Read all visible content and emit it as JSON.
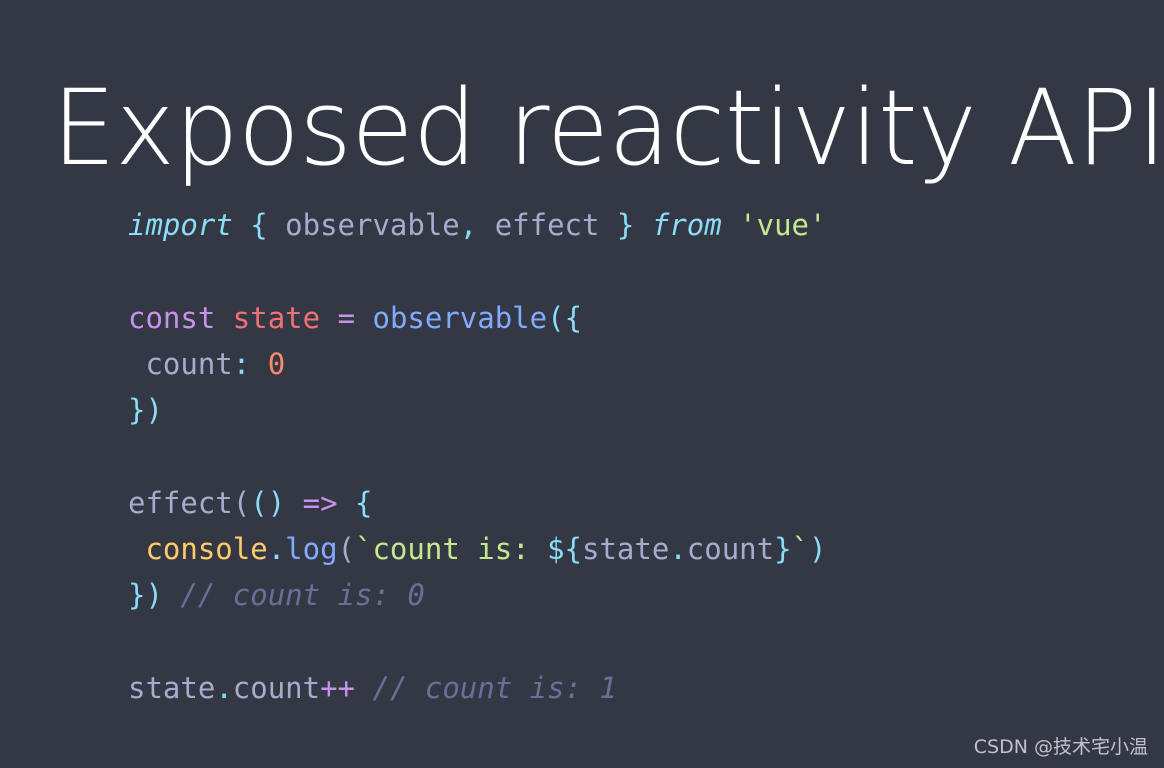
{
  "slide": {
    "title": "Exposed reactivity API",
    "background_color": "#343845",
    "title_color": "#FFFFFF"
  },
  "code": {
    "language": "javascript",
    "lines": [
      {
        "index": 1,
        "text": "import { observable, effect } from 'vue'",
        "tokens": [
          {
            "text": "import",
            "type": "keyword",
            "color": "#89DDF7"
          },
          {
            "text": " ",
            "type": "plain",
            "color": "#A6ACCD"
          },
          {
            "text": "{",
            "type": "punct",
            "color": "#89DDF7"
          },
          {
            "text": " observable",
            "type": "plain",
            "color": "#A6ACCD"
          },
          {
            "text": ",",
            "type": "punct",
            "color": "#89DDF7"
          },
          {
            "text": " effect ",
            "type": "plain",
            "color": "#A6ACCD"
          },
          {
            "text": "}",
            "type": "punct",
            "color": "#89DDF7"
          },
          {
            "text": " ",
            "type": "plain",
            "color": "#A6ACCD"
          },
          {
            "text": "from",
            "type": "keyword",
            "color": "#89DDF7"
          },
          {
            "text": " ",
            "type": "plain",
            "color": "#A6ACCD"
          },
          {
            "text": "'vue'",
            "type": "string",
            "color": "#C3E88D"
          }
        ]
      },
      {
        "index": 2,
        "text": "",
        "tokens": []
      },
      {
        "index": 3,
        "text": "const state = observable({",
        "tokens": [
          {
            "text": "const",
            "type": "const",
            "color": "#C792EA"
          },
          {
            "text": " ",
            "type": "plain",
            "color": "#A6ACCD"
          },
          {
            "text": "state",
            "type": "var",
            "color": "#F07178"
          },
          {
            "text": " ",
            "type": "plain",
            "color": "#A6ACCD"
          },
          {
            "text": "=",
            "type": "operator",
            "color": "#C792EA"
          },
          {
            "text": " ",
            "type": "plain",
            "color": "#A6ACCD"
          },
          {
            "text": "observable",
            "type": "func",
            "color": "#82AAFF"
          },
          {
            "text": "({",
            "type": "punct",
            "color": "#89DDF7"
          }
        ]
      },
      {
        "index": 4,
        "text": " count: 0",
        "tokens": [
          {
            "text": " count",
            "type": "plain",
            "color": "#A6ACCD"
          },
          {
            "text": ":",
            "type": "punct",
            "color": "#89DDF7"
          },
          {
            "text": " ",
            "type": "plain",
            "color": "#A6ACCD"
          },
          {
            "text": "0",
            "type": "number",
            "color": "#F78C6C"
          }
        ]
      },
      {
        "index": 5,
        "text": "})",
        "tokens": [
          {
            "text": "})",
            "type": "punct",
            "color": "#89DDF7"
          }
        ]
      },
      {
        "index": 6,
        "text": "",
        "tokens": []
      },
      {
        "index": 7,
        "text": "effect(() => {",
        "tokens": [
          {
            "text": "effect",
            "type": "plain",
            "color": "#A6ACCD"
          },
          {
            "text": "(",
            "type": "gray",
            "color": "#A6ACCD"
          },
          {
            "text": "()",
            "type": "punct",
            "color": "#89DDF7"
          },
          {
            "text": " ",
            "type": "plain",
            "color": "#A6ACCD"
          },
          {
            "text": "=>",
            "type": "operator",
            "color": "#C792EA"
          },
          {
            "text": " ",
            "type": "plain",
            "color": "#A6ACCD"
          },
          {
            "text": "{",
            "type": "punct",
            "color": "#89DDF7"
          }
        ]
      },
      {
        "index": 8,
        "text": " console.log(`count is: ${state.count}`)",
        "tokens": [
          {
            "text": " ",
            "type": "plain",
            "color": "#A6ACCD"
          },
          {
            "text": "console",
            "type": "object",
            "color": "#FFCB6B"
          },
          {
            "text": ".",
            "type": "punct",
            "color": "#89DDF7"
          },
          {
            "text": "log",
            "type": "func",
            "color": "#82AAFF"
          },
          {
            "text": "(",
            "type": "gray",
            "color": "#A6ACCD"
          },
          {
            "text": "`count is: ",
            "type": "string",
            "color": "#C3E88D"
          },
          {
            "text": "${",
            "type": "punct",
            "color": "#89DDF7"
          },
          {
            "text": "state",
            "type": "plain",
            "color": "#A6ACCD"
          },
          {
            "text": ".",
            "type": "punct",
            "color": "#89DDF7"
          },
          {
            "text": "count",
            "type": "plain",
            "color": "#A6ACCD"
          },
          {
            "text": "}",
            "type": "punct",
            "color": "#89DDF7"
          },
          {
            "text": "`",
            "type": "string",
            "color": "#C3E88D"
          },
          {
            "text": ")",
            "type": "punct",
            "color": "#89DDF7"
          }
        ]
      },
      {
        "index": 9,
        "text": "}) // count is: 0",
        "tokens": [
          {
            "text": "})",
            "type": "punct",
            "color": "#89DDF7"
          },
          {
            "text": " ",
            "type": "plain",
            "color": "#A6ACCD"
          },
          {
            "text": "// count is: 0",
            "type": "comment",
            "color": "#697098"
          }
        ]
      },
      {
        "index": 10,
        "text": "",
        "tokens": []
      },
      {
        "index": 11,
        "text": "state.count++ // count is: 1",
        "tokens": [
          {
            "text": "state",
            "type": "plain",
            "color": "#A6ACCD"
          },
          {
            "text": ".",
            "type": "punct",
            "color": "#89DDF7"
          },
          {
            "text": "count",
            "type": "plain",
            "color": "#A6ACCD"
          },
          {
            "text": "++",
            "type": "operator",
            "color": "#C792EA"
          },
          {
            "text": " ",
            "type": "plain",
            "color": "#A6ACCD"
          },
          {
            "text": "// count is: 1",
            "type": "comment",
            "color": "#697098"
          }
        ]
      }
    ]
  },
  "watermark": {
    "text": "CSDN @技术宅小温"
  }
}
